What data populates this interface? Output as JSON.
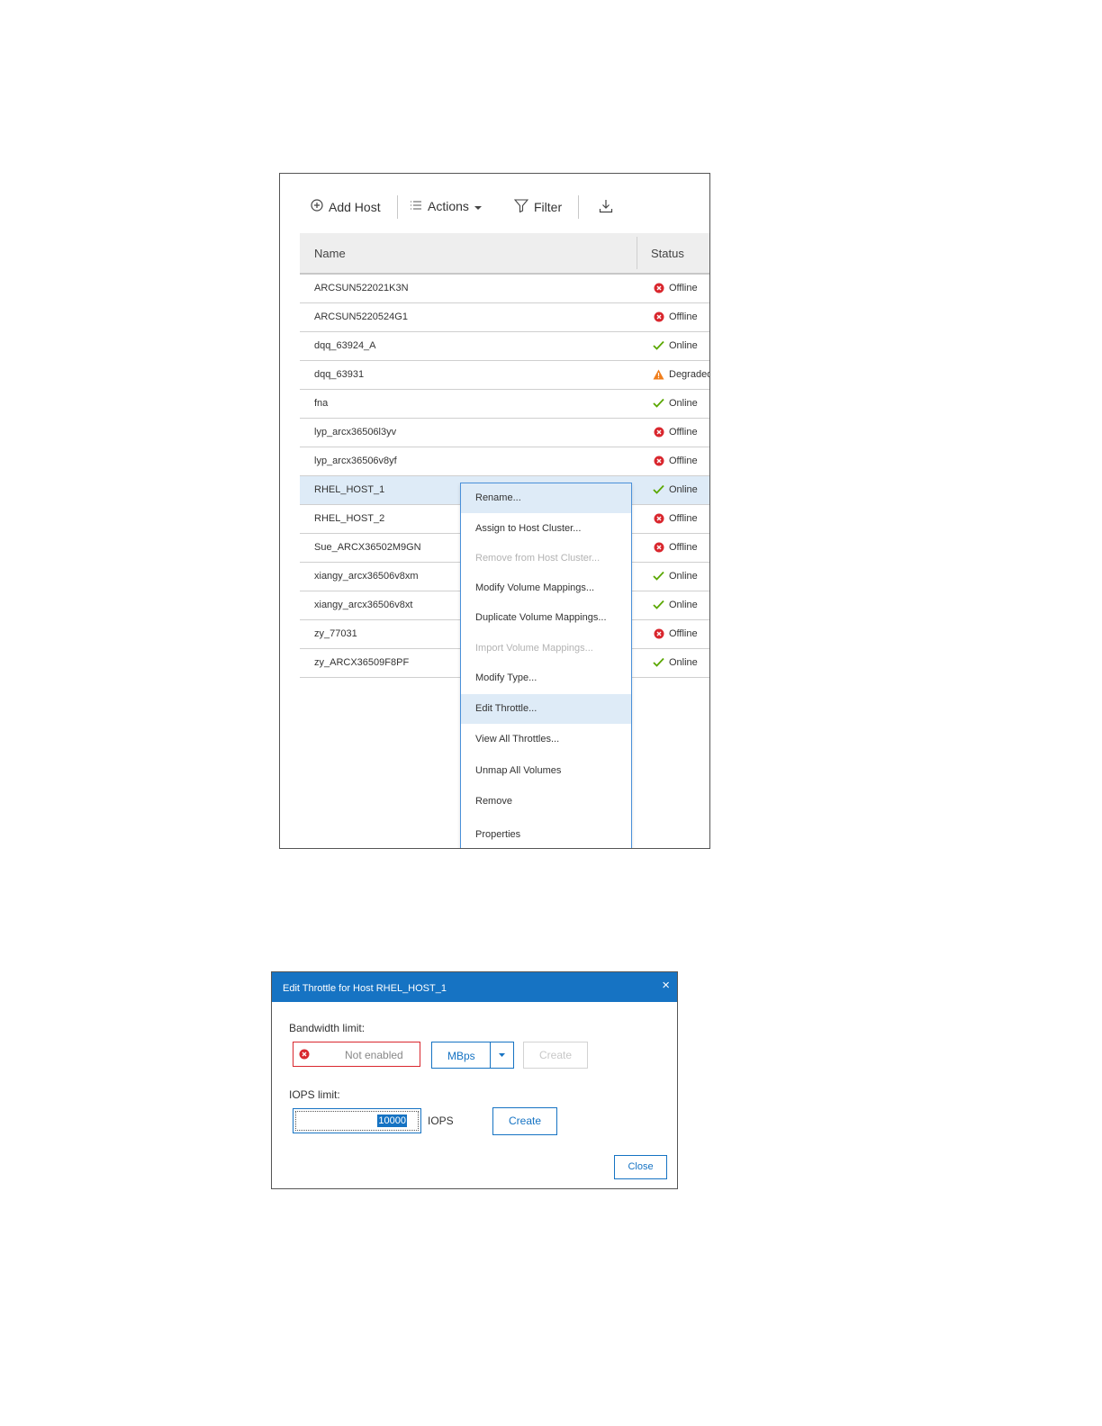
{
  "hosts_view": {
    "toolbar": {
      "add_host": "Add Host",
      "actions": "Actions",
      "filter": "Filter"
    },
    "columns": {
      "name": "Name",
      "status": "Status"
    },
    "rows": [
      {
        "name": "ARCSUN522021K3N",
        "status": "Offline",
        "state": "offline"
      },
      {
        "name": "ARCSUN5220524G1",
        "status": "Offline",
        "state": "offline"
      },
      {
        "name": "dqq_63924_A",
        "status": "Online",
        "state": "online"
      },
      {
        "name": "dqq_63931",
        "status": "Degraded",
        "state": "degraded"
      },
      {
        "name": "fna",
        "status": "Online",
        "state": "online"
      },
      {
        "name": "lyp_arcx36506l3yv",
        "status": "Offline",
        "state": "offline"
      },
      {
        "name": "lyp_arcx36506v8yf",
        "status": "Offline",
        "state": "offline"
      },
      {
        "name": "RHEL_HOST_1",
        "status": "Online",
        "state": "online",
        "selected": true
      },
      {
        "name": "RHEL_HOST_2",
        "status": "Offline",
        "state": "offline"
      },
      {
        "name": "Sue_ARCX36502M9GN",
        "status": "Offline",
        "state": "offline"
      },
      {
        "name": "xiangy_arcx36506v8xm",
        "status": "Online",
        "state": "online"
      },
      {
        "name": "xiangy_arcx36506v8xt",
        "status": "Online",
        "state": "online"
      },
      {
        "name": "zy_77031",
        "status": "Offline",
        "state": "offline"
      },
      {
        "name": "zy_ARCX36509F8PF",
        "status": "Online",
        "state": "online"
      }
    ],
    "context_menu": [
      {
        "label": "Rename...",
        "disabled": false
      },
      {
        "label": "Assign to Host Cluster...",
        "disabled": false
      },
      {
        "label": "Remove from Host Cluster...",
        "disabled": true
      },
      {
        "label": "Modify Volume Mappings...",
        "disabled": false
      },
      {
        "label": "Duplicate Volume Mappings...",
        "disabled": false
      },
      {
        "label": "Import Volume Mappings...",
        "disabled": true
      },
      {
        "label": "Modify Type...",
        "disabled": false
      },
      {
        "label": "Edit Throttle...",
        "disabled": false,
        "highlighted": true
      },
      {
        "label": "View All Throttles...",
        "disabled": false
      },
      {
        "label": "Unmap All Volumes",
        "disabled": false
      },
      {
        "label": "Remove",
        "disabled": false
      },
      {
        "label": "Properties",
        "disabled": false
      }
    ]
  },
  "throttle_dialog": {
    "title": "Edit Throttle for Host RHEL_HOST_1",
    "close_icon": "×",
    "bandwidth_label": "Bandwidth limit:",
    "bandwidth_value": "Not enabled",
    "bandwidth_unit": "MBps",
    "bandwidth_create": "Create",
    "iops_label": "IOPS limit:",
    "iops_value": "10000",
    "iops_unit": "IOPS",
    "iops_create": "Create",
    "close_button": "Close"
  },
  "colors": {
    "accent": "#1673c3",
    "offline": "#d9272e",
    "online": "#5aa700",
    "degraded": "#f07e1b",
    "selected_row": "#deebf7"
  }
}
